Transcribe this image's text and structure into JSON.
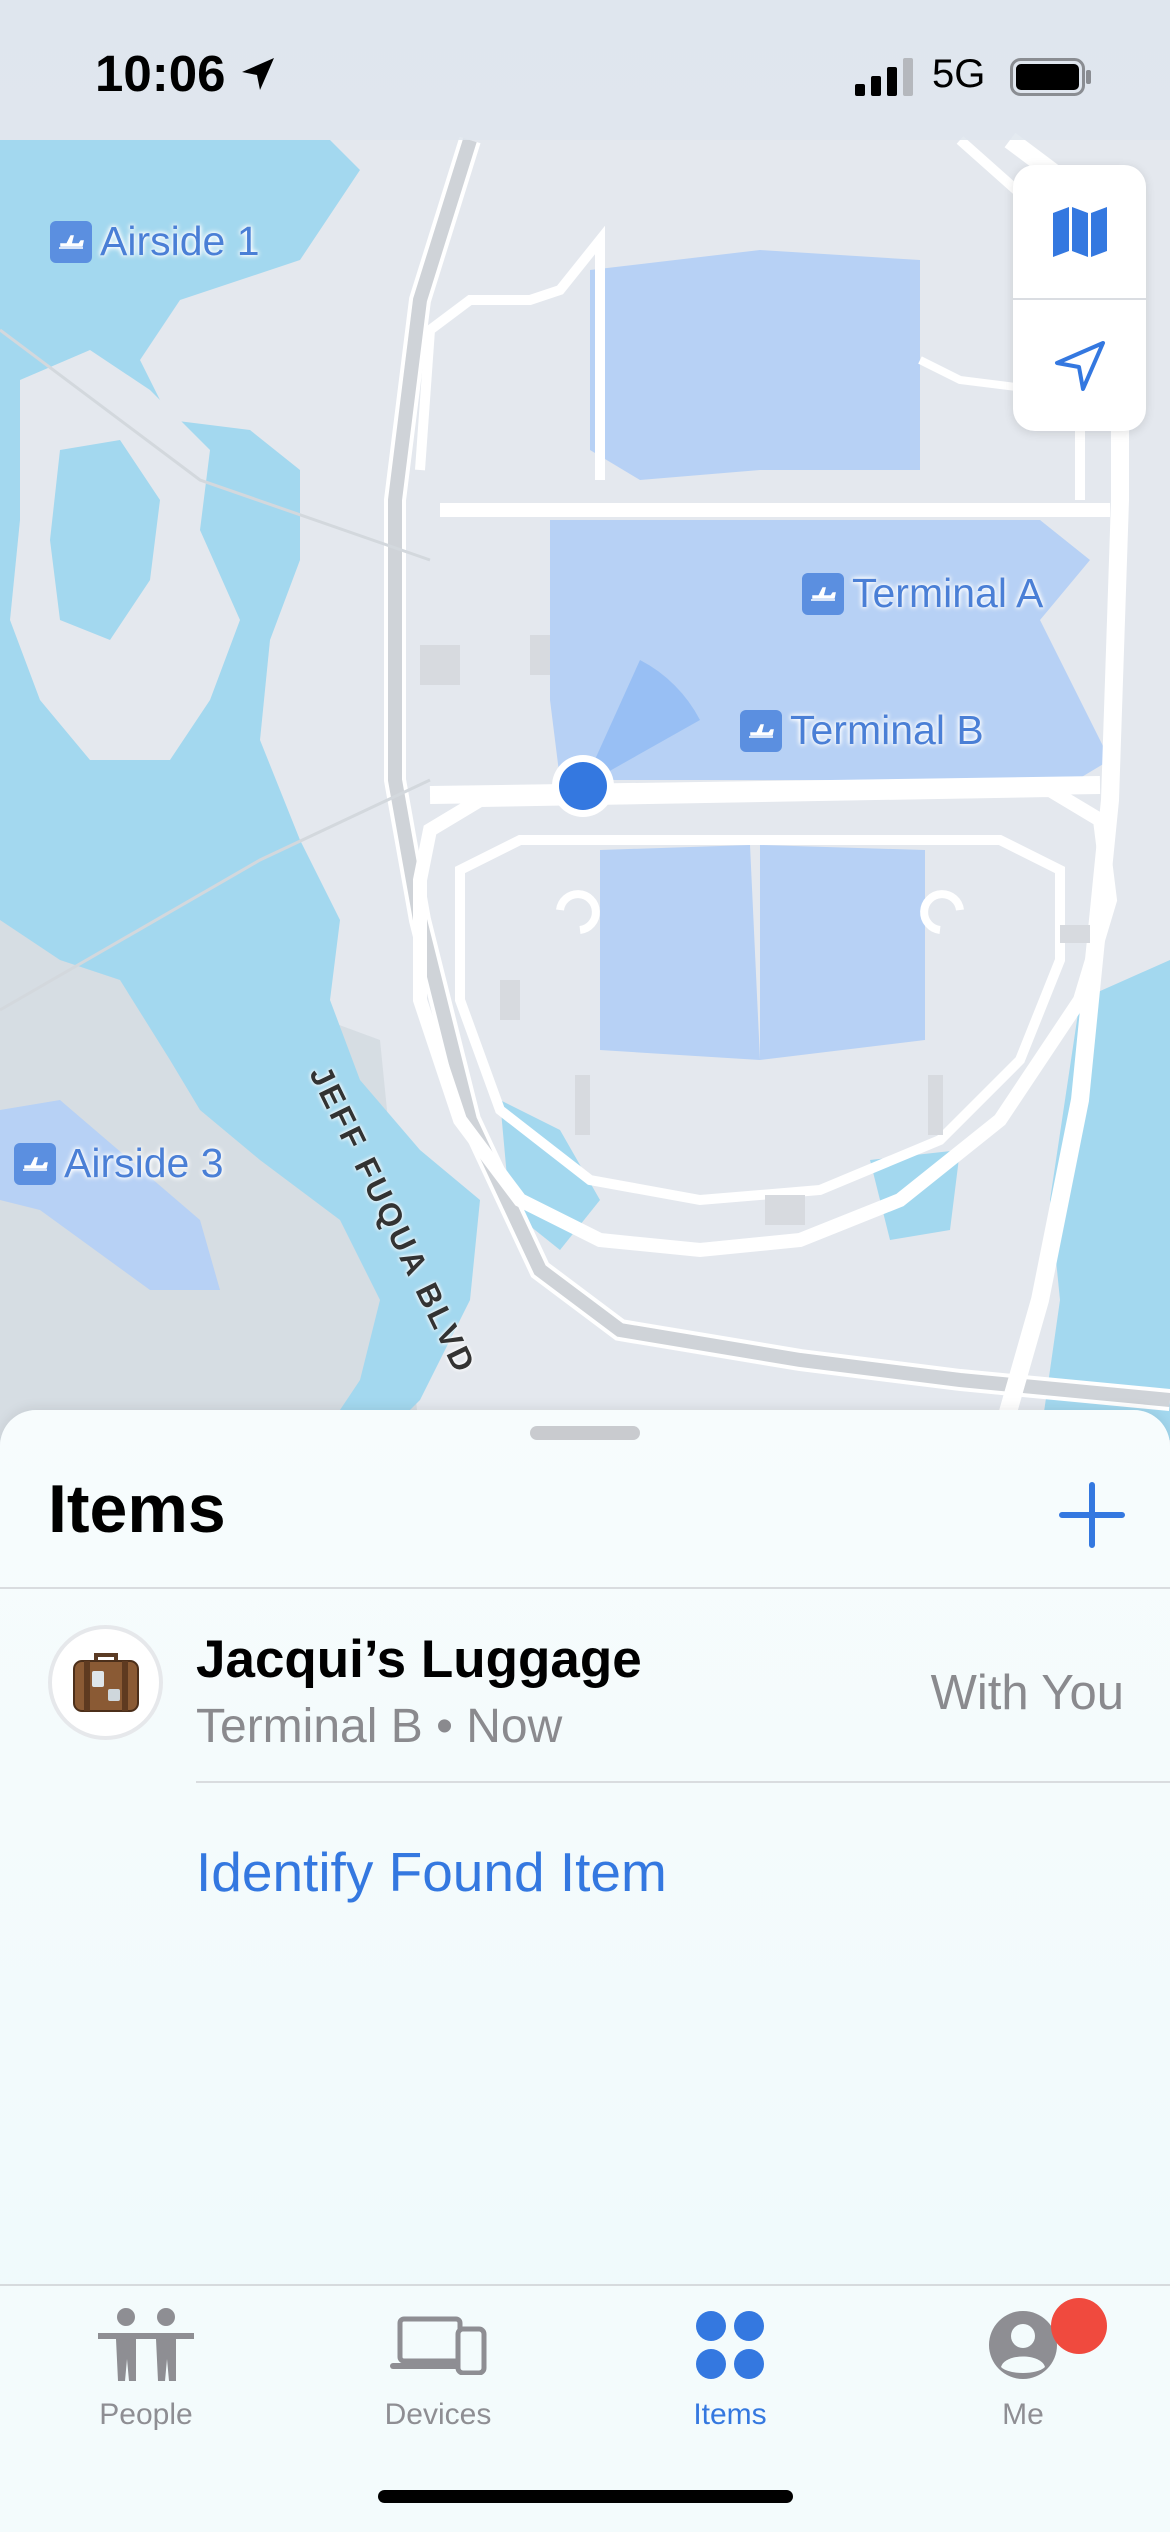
{
  "status_bar": {
    "time": "10:06",
    "network": "5G"
  },
  "map": {
    "poi": [
      {
        "label": "Airside 1"
      },
      {
        "label": "Terminal A"
      },
      {
        "label": "Terminal B"
      },
      {
        "label": "Airside 3"
      }
    ],
    "road_label": "JEFF FUQUA BLVD"
  },
  "sheet": {
    "title": "Items",
    "items": [
      {
        "name": "Jacqui’s Luggage",
        "detail": "Terminal B • Now",
        "status": "With You",
        "icon": "luggage-icon"
      }
    ],
    "identify_link": "Identify Found Item"
  },
  "tabs": [
    {
      "label": "People",
      "icon": "people-icon"
    },
    {
      "label": "Devices",
      "icon": "devices-icon"
    },
    {
      "label": "Items",
      "icon": "items-icon",
      "active": true
    },
    {
      "label": "Me",
      "icon": "me-icon",
      "badge": true
    }
  ],
  "colors": {
    "accent": "#3478e0",
    "water": "#9dd6ef",
    "terminal": "#b7d1f5",
    "badge": "#f04a3e"
  }
}
